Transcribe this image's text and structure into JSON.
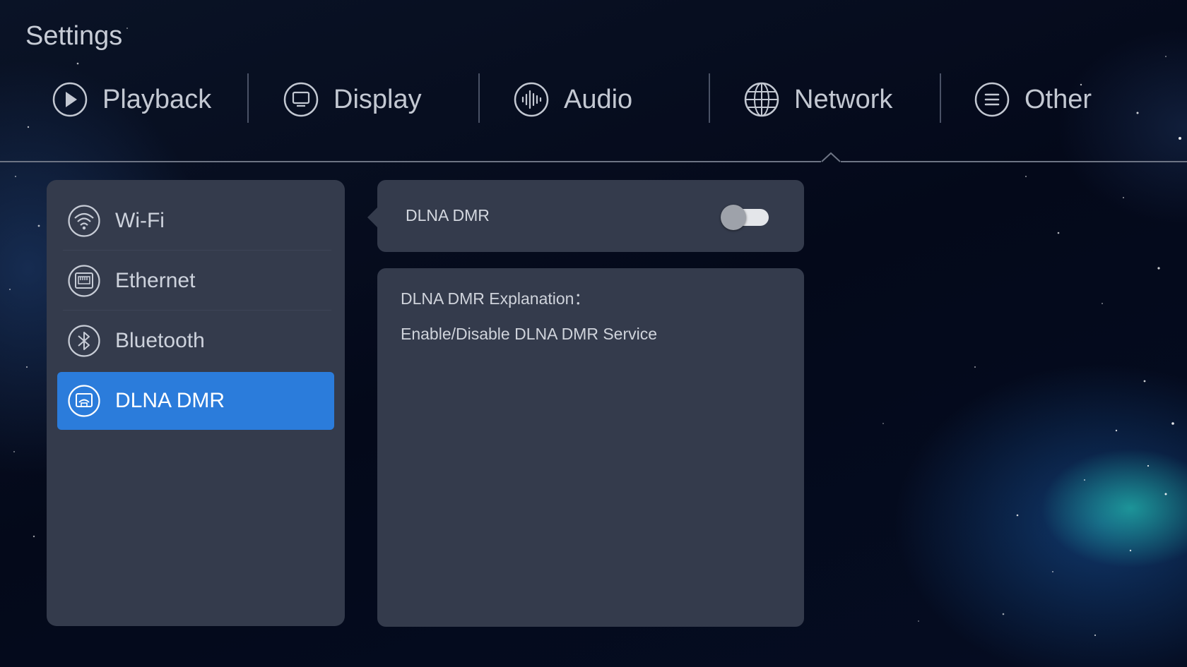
{
  "header": {
    "title": "Settings"
  },
  "tabs": [
    {
      "label": "Playback",
      "icon": "play-icon"
    },
    {
      "label": "Display",
      "icon": "display-icon"
    },
    {
      "label": "Audio",
      "icon": "audio-icon"
    },
    {
      "label": "Network",
      "icon": "globe-icon",
      "selected": true
    },
    {
      "label": "Other",
      "icon": "menu-icon"
    }
  ],
  "sidebar": {
    "items": [
      {
        "label": "Wi-Fi",
        "icon": "wifi-icon"
      },
      {
        "label": "Ethernet",
        "icon": "ethernet-icon"
      },
      {
        "label": "Bluetooth",
        "icon": "bluetooth-icon"
      },
      {
        "label": "DLNA DMR",
        "icon": "cast-icon",
        "selected": true
      }
    ]
  },
  "detail": {
    "toggle_label": "DLNA DMR",
    "toggle_on": false,
    "explanation_title": "DLNA DMR Explanation：",
    "explanation_text": "Enable/Disable DLNA DMR Service"
  },
  "colors": {
    "panel": "#343b4c",
    "accent": "#2b7cdb",
    "text": "#cdd2dc"
  }
}
